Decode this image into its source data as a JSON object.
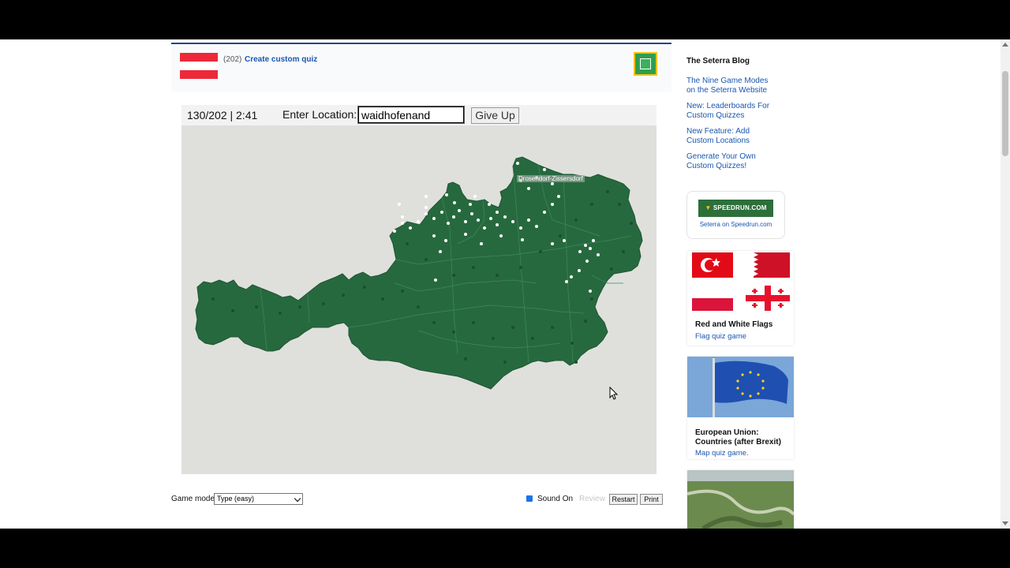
{
  "quiz": {
    "count": "(202)",
    "custom_link": "Create custom quiz",
    "score": "130/202 | 2:41",
    "enter_label": "Enter Location:",
    "input_value": "waidhofenand",
    "give_up": "Give Up",
    "map_town_label": "Drosendorf-Zissersdorf"
  },
  "controls": {
    "game_mode_label": "Game mode:",
    "game_mode_value": "Type (easy)",
    "sound_label": "Sound On",
    "review_label": "Review",
    "restart": "Restart",
    "print": "Print"
  },
  "sidebar": {
    "blog_title": "The Seterra Blog",
    "blog_links": [
      "The Nine Game Modes on the Seterra Website",
      "New: Leaderboards For Custom Quizzes",
      "New Feature: Add Custom Locations",
      "Generate Your Own Custom Quizzes!"
    ],
    "speedrun_logo": "SPEEDRUN.COM",
    "speedrun_caption": "Seterra on Speedrun.com",
    "cards": [
      {
        "title": "Red and White Flags",
        "subtitle": "Flag quiz game"
      },
      {
        "title": "European Union: Countries (after Brexit)",
        "subtitle": "Map quiz game."
      }
    ]
  },
  "colors": {
    "map_green": "#27693f",
    "flag_red": "#ed2939",
    "link_blue": "#1a56b0",
    "eu_blue": "#1f4fb0"
  }
}
